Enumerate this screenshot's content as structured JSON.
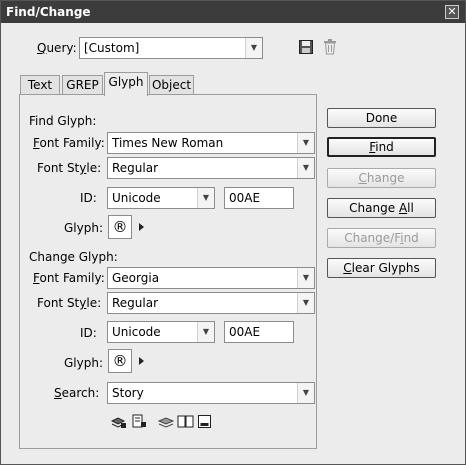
{
  "window": {
    "title": "Find/Change",
    "close_glyph": "✕"
  },
  "query": {
    "label": "Query:",
    "value": "[Custom]",
    "save_icon": "save-query-icon",
    "delete_icon": "delete-query-icon"
  },
  "tabs": [
    {
      "label": "Text"
    },
    {
      "label": "GREP"
    },
    {
      "label": "Glyph",
      "active": true
    },
    {
      "label": "Object"
    }
  ],
  "find_glyph": {
    "heading": "Find Glyph:",
    "font_family_label": "Font Family:",
    "font_family": "Times New Roman",
    "font_style_label": "Font Style:",
    "font_style": "Regular",
    "id_label": "ID:",
    "id_type": "Unicode",
    "id_value": "00AE",
    "glyph_label": "Glyph:",
    "glyph": "®"
  },
  "change_glyph": {
    "heading": "Change Glyph:",
    "font_family_label": "Font Family:",
    "font_family": "Georgia",
    "font_style_label": "Font Style:",
    "font_style": "Regular",
    "id_label": "ID:",
    "id_type": "Unicode",
    "id_value": "00AE",
    "glyph_label": "Glyph:",
    "glyph": "®"
  },
  "search": {
    "label": "Search:",
    "value": "Story"
  },
  "buttons": {
    "done": "Done",
    "find": "Find",
    "change": "Change",
    "change_all": "Change All",
    "change_find": "Change/Find",
    "clear_glyphs": "Clear Glyphs"
  },
  "option_icons": [
    "include-locked-layers-icon",
    "include-locked-stories-icon",
    "include-hidden-layers-icon",
    "include-master-pages-icon",
    "include-footnotes-icon"
  ],
  "colors": {
    "titlebar": "#3c3c3c",
    "dialog_bg": "#ececec"
  }
}
